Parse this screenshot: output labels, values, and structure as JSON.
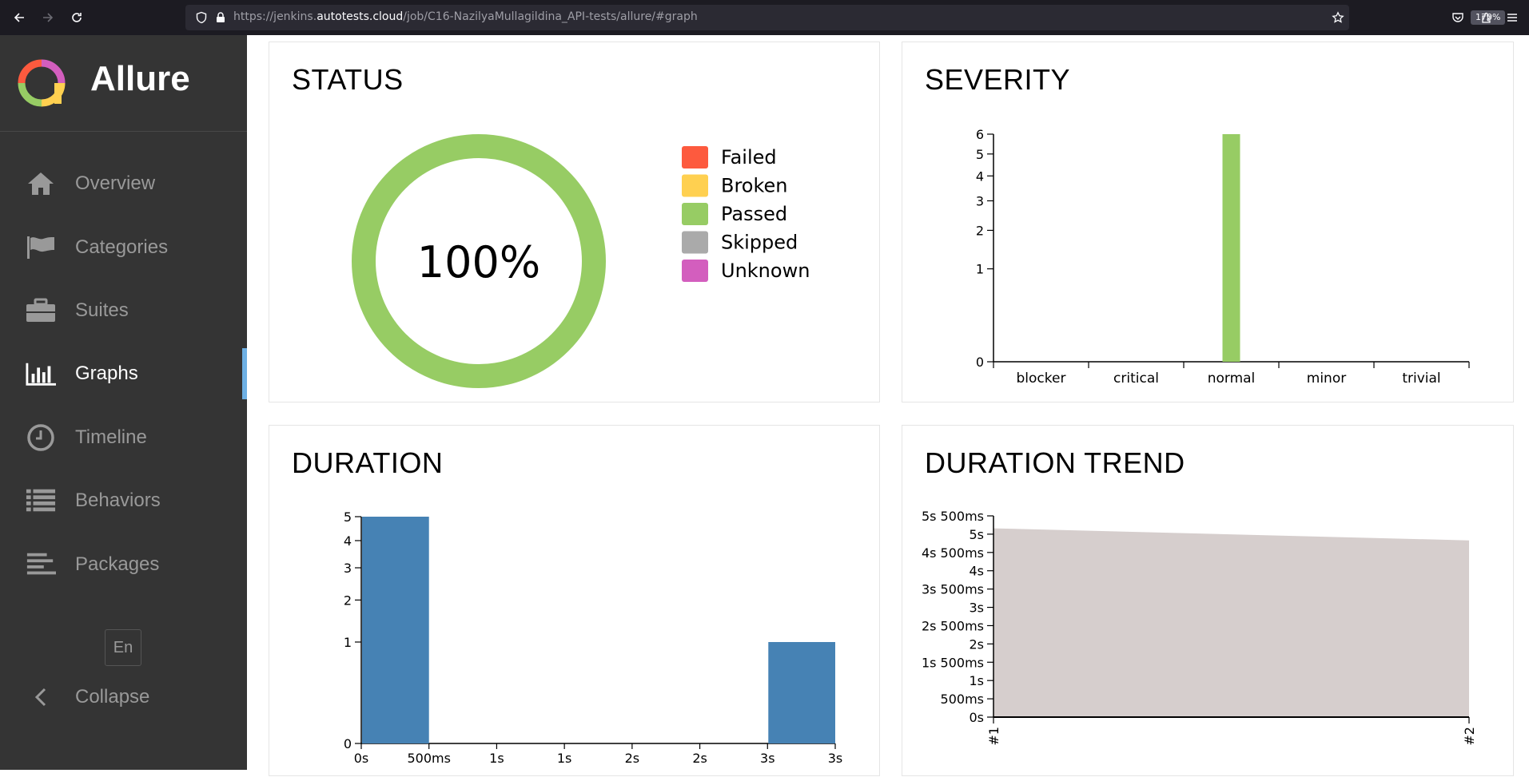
{
  "browser": {
    "url_prefix": "https://jenkins.",
    "url_host": "autotests.cloud",
    "url_path": "/job/C16-NazilyaMullagildina_API-tests/allure/#graph",
    "zoom": "170%"
  },
  "sidebar": {
    "brand": "Allure",
    "items": [
      {
        "label": "Overview",
        "icon": "home-icon"
      },
      {
        "label": "Categories",
        "icon": "flag-icon"
      },
      {
        "label": "Suites",
        "icon": "briefcase-icon"
      },
      {
        "label": "Graphs",
        "icon": "bar-chart-icon",
        "active": true
      },
      {
        "label": "Timeline",
        "icon": "clock-icon"
      },
      {
        "label": "Behaviors",
        "icon": "list-icon"
      },
      {
        "label": "Packages",
        "icon": "align-left-icon"
      }
    ],
    "language": "En",
    "collapse": "Collapse"
  },
  "colors": {
    "failed": "#fd5a3e",
    "broken": "#ffd050",
    "passed": "#97cc64",
    "skipped": "#aaaaaa",
    "unknown": "#d35ebe",
    "duration_bar": "#4682b4",
    "trend_area": "#d6cecd",
    "sidebar_bg": "#343434",
    "active_accent": "#6eb0e4"
  },
  "panels": {
    "status": "STATUS",
    "severity": "SEVERITY",
    "duration": "DURATION",
    "duration_trend": "DURATION TREND"
  },
  "chart_data": [
    {
      "type": "pie",
      "title": "STATUS",
      "center_label": "100%",
      "categories": [
        "Failed",
        "Broken",
        "Passed",
        "Skipped",
        "Unknown"
      ],
      "values": [
        0,
        0,
        6,
        0,
        0
      ],
      "legend": "right"
    },
    {
      "type": "bar",
      "title": "SEVERITY",
      "categories": [
        "blocker",
        "critical",
        "normal",
        "minor",
        "trivial"
      ],
      "values": [
        0,
        0,
        6,
        0,
        0
      ],
      "yticks": [
        "0",
        "1",
        "2",
        "3",
        "4",
        "5",
        "6"
      ],
      "ylim": [
        0,
        6
      ],
      "scale": "sqrt"
    },
    {
      "type": "bar",
      "title": "DURATION",
      "xticks": [
        "0s",
        "500ms",
        "1s",
        "1s",
        "2s",
        "2s",
        "3s",
        "3s"
      ],
      "bins": [
        {
          "from": 0,
          "to": 1,
          "value": 5
        },
        {
          "from": 6,
          "to": 7,
          "value": 1
        }
      ],
      "yticks": [
        "0",
        "1",
        "2",
        "3",
        "4",
        "5"
      ],
      "ylim": [
        0,
        5
      ],
      "scale": "sqrt"
    },
    {
      "type": "area",
      "title": "DURATION TREND",
      "x": [
        "#1",
        "#2"
      ],
      "values_ms": [
        5160,
        4830
      ],
      "yticks": [
        "0s",
        "500ms",
        "1s",
        "1s 500ms",
        "2s",
        "2s 500ms",
        "3s",
        "3s 500ms",
        "4s",
        "4s 500ms",
        "5s",
        "5s 500ms"
      ],
      "ytick_values_ms": [
        0,
        500,
        1000,
        1500,
        2000,
        2500,
        3000,
        3500,
        4000,
        4500,
        5000,
        5500
      ],
      "ylim_ms": [
        0,
        5500
      ]
    }
  ]
}
